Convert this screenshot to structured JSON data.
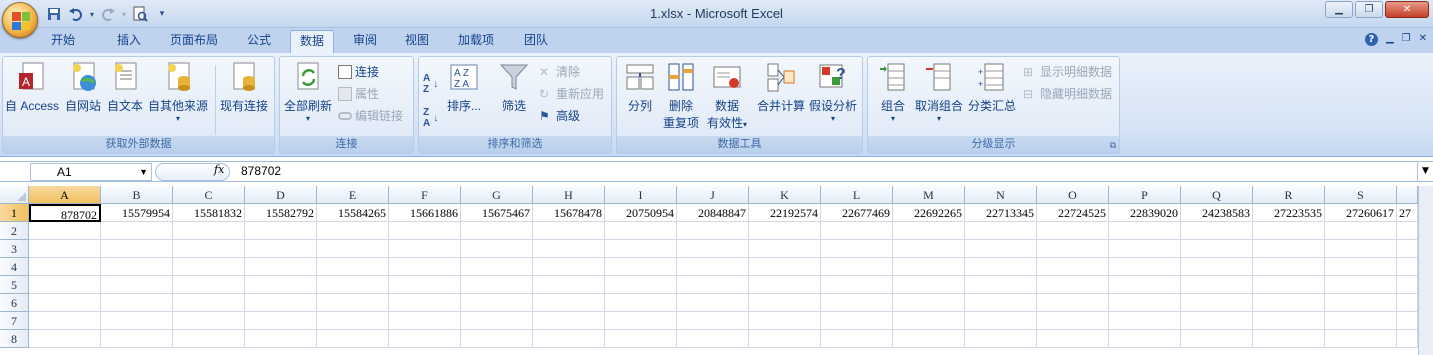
{
  "window": {
    "title": "1.xlsx - Microsoft Excel",
    "buttons": [
      "minimize-button",
      "maximize-button",
      "close-button"
    ]
  },
  "qat": {
    "icons": [
      "save-icon",
      "undo-icon",
      "redo-icon",
      "print-preview-icon",
      "customize-icon"
    ]
  },
  "tabs": [
    {
      "label": "开始"
    },
    {
      "label": "插入"
    },
    {
      "label": "页面布局"
    },
    {
      "label": "公式"
    },
    {
      "label": "数据",
      "active": true
    },
    {
      "label": "审阅"
    },
    {
      "label": "视图"
    },
    {
      "label": "加载项"
    },
    {
      "label": "团队"
    }
  ],
  "ribbon": {
    "get_external": {
      "label": "获取外部数据",
      "access": "自 Access",
      "web": "自网站",
      "text": "自文本",
      "other": "自其他来源",
      "existing": "现有连接"
    },
    "connections": {
      "label": "连接",
      "refresh": "全部刷新",
      "connections": "连接",
      "properties": "属性",
      "edit_links": "编辑链接"
    },
    "sort_filter": {
      "label": "排序和筛选",
      "sort": "排序...",
      "filter": "筛选",
      "clear": "清除",
      "reapply": "重新应用",
      "advanced": "高级"
    },
    "data_tools": {
      "label": "数据工具",
      "split": "分列",
      "remove_dup_1": "删除",
      "remove_dup_2": "重复项",
      "validation_1": "数据",
      "validation_2": "有效性",
      "consolidate": "合并计算",
      "whatif": "假设分析"
    },
    "outline": {
      "label": "分级显示",
      "group": "组合",
      "ungroup": "取消组合",
      "subtotal": "分类汇总",
      "show_detail": "显示明细数据",
      "hide_detail": "隐藏明细数据"
    }
  },
  "formula_bar": {
    "name_box": "A1",
    "fx": "fx",
    "content": "878702"
  },
  "sheet": {
    "columns": [
      "A",
      "B",
      "C",
      "D",
      "E",
      "F",
      "G",
      "H",
      "I",
      "J",
      "K",
      "L",
      "M",
      "N",
      "O",
      "P",
      "Q",
      "R",
      "S"
    ],
    "rows": [
      "1",
      "2",
      "3",
      "4",
      "5",
      "6",
      "7",
      "8"
    ],
    "row1": [
      "878702",
      "15579954",
      "15581832",
      "15582792",
      "15584265",
      "15661886",
      "15675467",
      "15678478",
      "20750954",
      "20848847",
      "22192574",
      "22677469",
      "22692265",
      "22713345",
      "22724525",
      "22839020",
      "24238583",
      "27223535",
      "27260617",
      "27"
    ]
  }
}
